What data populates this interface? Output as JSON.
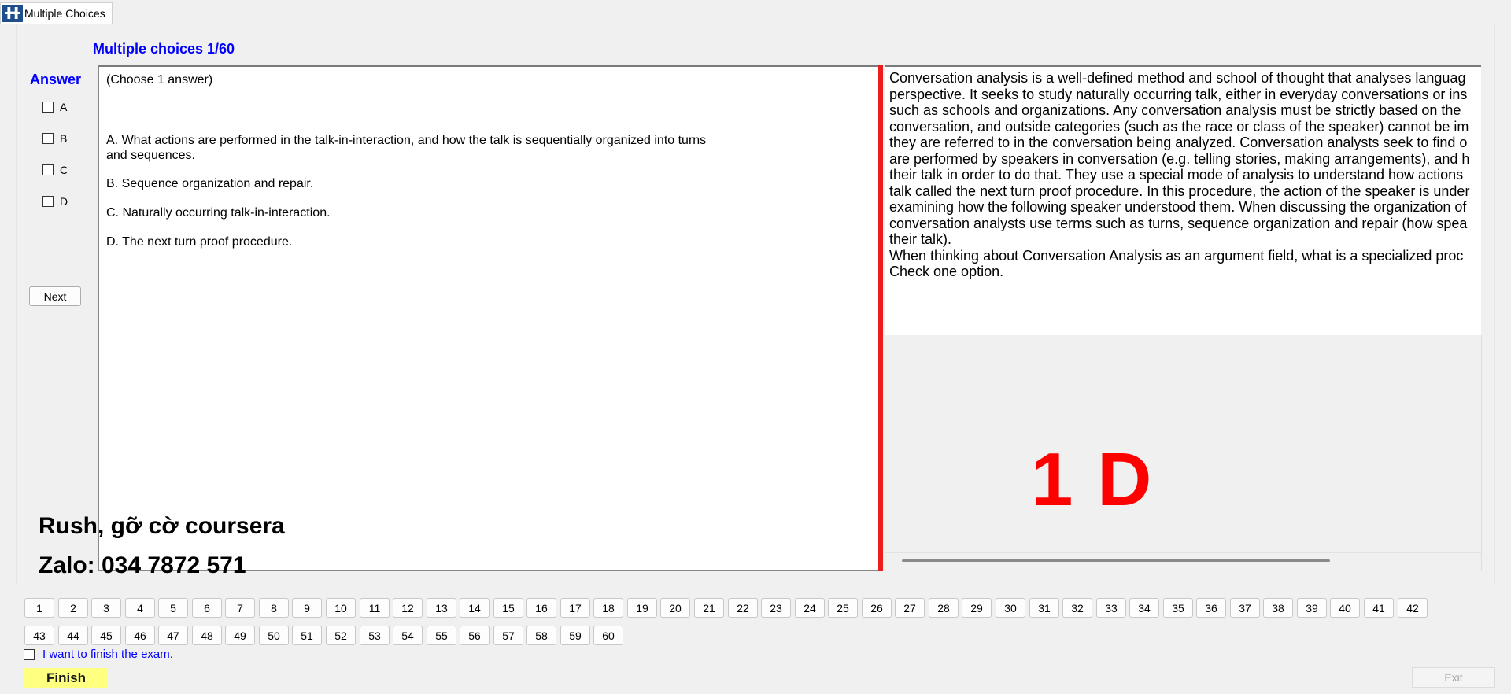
{
  "tab": {
    "label": "Multiple Choices",
    "logo_letter": "H"
  },
  "heading": "Multiple choices 1/60",
  "answer_panel": {
    "title": "Answer",
    "choices": [
      "A",
      "B",
      "C",
      "D"
    ],
    "next_label": "Next"
  },
  "question": {
    "instruction": "(Choose 1 answer)",
    "options": [
      "A.  What actions are performed in the talk-in-interaction, and how the talk is sequentially organized into turns and sequences.",
      "B.  Sequence organization and repair.",
      "C.  Naturally occurring talk-in-interaction.",
      "D.  The next turn proof procedure."
    ]
  },
  "passage": {
    "lines": [
      "Conversation analysis is a well-defined method and school of thought that analyses languag",
      "perspective. It seeks to study naturally occurring talk, either in everyday conversations or ins",
      "such as schools and organizations. Any conversation analysis must be strictly based on the",
      "conversation, and outside categories (such as the race or class of the speaker) cannot be im",
      "they are referred to in the conversation being analyzed. Conversation analysts seek to find o",
      "are performed by speakers in conversation (e.g. telling stories, making arrangements), and h",
      "their talk in order to do that. They use a special mode of analysis to understand how actions",
      "talk called the next turn proof procedure. In this procedure, the action of the speaker is under",
      "examining how the following speaker understood them. When discussing the organization of",
      "conversation analysts use terms such as turns, sequence organization and repair (how spea",
      "their talk).",
      "When thinking about Conversation Analysis as an argument field, what is a specialized proc",
      "Check one option."
    ]
  },
  "big_answer": "1 D",
  "overlay": {
    "line1": "Rush, gỡ cờ coursera",
    "line2": "Zalo: 034 7872 571"
  },
  "question_numbers": [
    "1",
    "2",
    "3",
    "4",
    "5",
    "6",
    "7",
    "8",
    "9",
    "10",
    "11",
    "12",
    "13",
    "14",
    "15",
    "16",
    "17",
    "18",
    "19",
    "20",
    "21",
    "22",
    "23",
    "24",
    "25",
    "26",
    "27",
    "28",
    "29",
    "30",
    "31",
    "32",
    "33",
    "34",
    "35",
    "36",
    "37",
    "38",
    "39",
    "40",
    "41",
    "42",
    "43",
    "44",
    "45",
    "46",
    "47",
    "48",
    "49",
    "50",
    "51",
    "52",
    "53",
    "54",
    "55",
    "56",
    "57",
    "58",
    "59",
    "60"
  ],
  "finish_check_label": "I want to finish the exam.",
  "finish_label": "Finish",
  "exit_label": "Exit",
  "colors": {
    "heading_blue": "#0000ff",
    "answer_red": "#ff0000",
    "finish_yellow": "#ffff80"
  }
}
